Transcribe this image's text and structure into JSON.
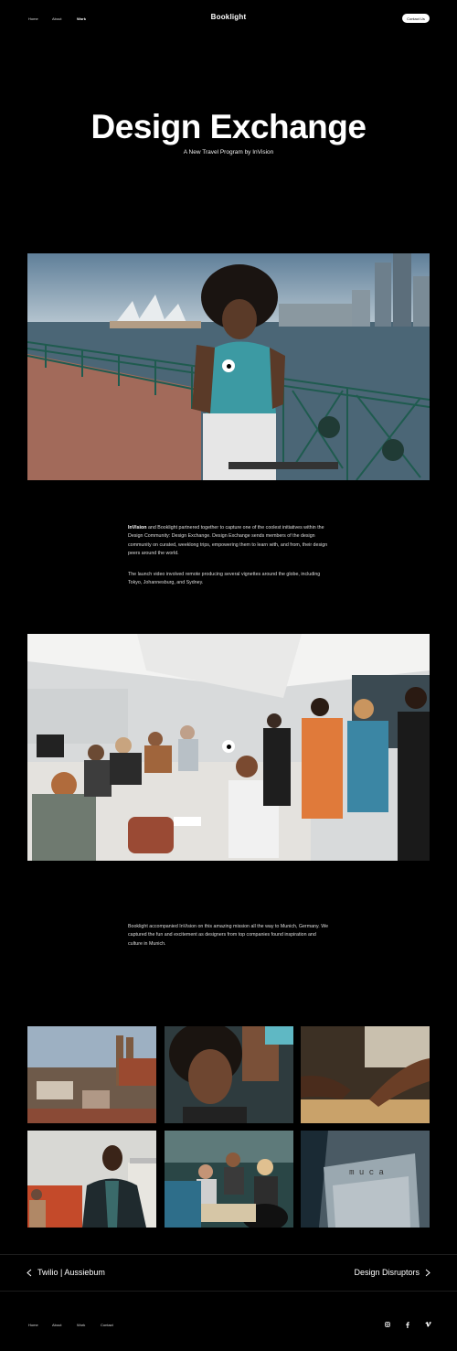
{
  "nav": {
    "home": "Home",
    "about": "About",
    "work": "Work",
    "contact_button": "Contact Us"
  },
  "brand": {
    "logo": "Booklight"
  },
  "hero": {
    "title": "Design Exchange",
    "subtitle": "A New Travel Program by InVision"
  },
  "intro": {
    "brand_bold": "InVision",
    "p1_rest": " and Booklight partnered together to capture one of the coolest initiatives within the Design Community: Design Exchange. Design Exchange sends members of the design community on curated, weeklong trips, empowering them to learn with, and from, their design peers around the world.",
    "p2": "The launch video involved remote producing several vignettes around the globe, including Tokyo, Johannesburg, and Sydney."
  },
  "munich": {
    "p1": "Booklight accompanied InVision on this amazing mission all the way to Munich, Germany. We captured the fun and excitement as designers from top companies found inspiration and culture in Munich."
  },
  "gallery": {
    "mucja_sign": "m u c a"
  },
  "pagination": {
    "prev_label": "Twilio | Aussiebum",
    "next_label": "Design Disruptors"
  },
  "footer": {
    "home": "Home",
    "about": "About",
    "work": "Work",
    "contact": "Contact"
  },
  "colors": {
    "background": "#000000",
    "text": "#ffffff"
  },
  "icons": [
    "play-icon",
    "chevron-left-icon",
    "chevron-right-icon",
    "instagram-icon",
    "facebook-icon",
    "vimeo-icon"
  ]
}
